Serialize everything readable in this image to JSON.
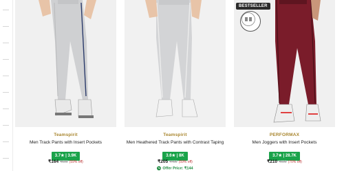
{
  "products": [
    {
      "brand": "Teamspirit",
      "title": "Men Track Pants with Insert Pockets",
      "rating": "3.7★ | 3.9K",
      "price": "₹164",
      "mrp": "₹699",
      "discount": "(59% off)",
      "colors": {
        "pant": "#cfd0d2",
        "stripe": "#2a3a6a",
        "shoe": "#e9e9e9"
      }
    },
    {
      "brand": "Teamspirit",
      "title": "Men Heathered Track Pants with Contrast Taping",
      "rating": "3.6★ | 8K",
      "price": "₹205",
      "mrp": "₹499",
      "discount": "(59% off)",
      "offer": "Offer Price: ₹144",
      "colors": {
        "pant": "#d3d4d6",
        "stripe": "#eeeeee",
        "shoe": "#f2f2f2"
      }
    },
    {
      "badge": "BESTSELLER",
      "brand": "PERFORMAX",
      "title": "Men Joggers with Insert Pockets",
      "rating": "3.7★ | 28.7K",
      "price": "₹210",
      "mrp": "₹699",
      "discount": "(70% off)",
      "colors": {
        "pant": "#7a1c2a",
        "stripe": "#4a1018",
        "shoe": "#e04040"
      }
    }
  ],
  "accent": {
    "rating_bg": "#1aa34a",
    "brand_color": "#a8852d",
    "offer_color": "#1a8a3d"
  }
}
